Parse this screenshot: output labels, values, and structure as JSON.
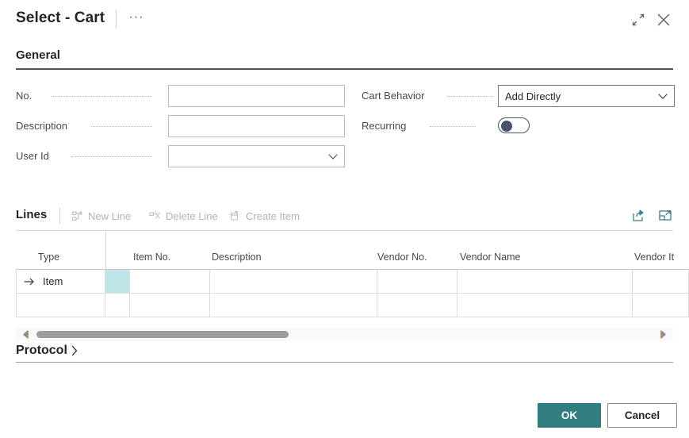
{
  "window": {
    "title": "Select - Cart",
    "ellipsis": "···",
    "expand_icon": "expand-icon",
    "close_icon": "close-icon"
  },
  "general": {
    "header": "General",
    "fields_left": [
      {
        "label": "No.",
        "value": "",
        "placeholder": "",
        "type": "text"
      },
      {
        "label": "Description",
        "value": "",
        "placeholder": "",
        "type": "text"
      },
      {
        "label": "User Id",
        "value": "",
        "placeholder": "",
        "type": "dropdown"
      }
    ],
    "fields_right": [
      {
        "label": "Cart Behavior",
        "value": "Add Directly",
        "placeholder": "",
        "type": "dropdown"
      },
      {
        "label": "Recurring",
        "value": "Off",
        "type": "toggle"
      }
    ],
    "cart_behavior_options": [
      "Add Directly"
    ]
  },
  "lines": {
    "title": "Lines",
    "toolbar": [
      {
        "label": "New Line",
        "icon": "new-line-icon",
        "enabled": false
      },
      {
        "label": "Delete Line",
        "icon": "delete-line-icon",
        "enabled": false
      },
      {
        "label": "Create Item",
        "icon": "create-item-icon",
        "enabled": false
      }
    ],
    "actions": [
      {
        "icon": "share-icon",
        "label": "Share"
      },
      {
        "icon": "open-in-new-window-icon",
        "label": "Open in Excel"
      }
    ],
    "columns": [
      {
        "header": "Type"
      },
      {
        "header": ""
      },
      {
        "header": "Item No."
      },
      {
        "header": "Description"
      },
      {
        "header": "Vendor No."
      },
      {
        "header": "Vendor Name"
      },
      {
        "header": "Vendor It"
      }
    ],
    "rows": [
      {
        "indicator": "current-row-arrow",
        "cells": [
          "Item",
          "",
          "",
          "",
          "",
          "",
          ""
        ],
        "selected_cell_index": 1
      },
      {
        "indicator": "",
        "cells": [
          "",
          "",
          "",
          "",
          "",
          "",
          ""
        ],
        "selected_cell_index": -1
      }
    ],
    "scrollbar": {
      "left_arrow": "scroll-left-arrow",
      "right_arrow": "scroll-right-arrow",
      "thumb_position_pct": 0,
      "thumb_width_pct": 40
    }
  },
  "protocol": {
    "label": "Protocol",
    "chevron": "chevron-right-icon",
    "expanded": false
  },
  "footer": {
    "ok_label": "OK",
    "cancel_label": "Cancel"
  },
  "colors": {
    "accent_teal": "#317e80",
    "selected_cell": "#bfe6e6",
    "rule_dark": "#4b5563",
    "disabled_text": "#b3b3b3"
  }
}
